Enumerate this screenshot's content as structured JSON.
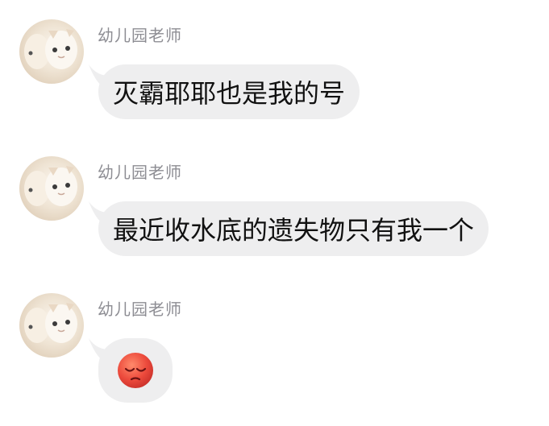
{
  "messages": [
    {
      "sender": "幼儿园老师",
      "text": "灭霸耶耶也是我的号"
    },
    {
      "sender": "幼儿园老师",
      "text": "最近收水底的遗失物只有我一个"
    },
    {
      "sender": "幼儿园老师",
      "emoji": "pensive-red-face-emoji"
    }
  ],
  "colors": {
    "bubble": "#eeeeef",
    "sender_name": "#8d8d93",
    "text": "#111111",
    "emoji_face": "#e8463b"
  }
}
